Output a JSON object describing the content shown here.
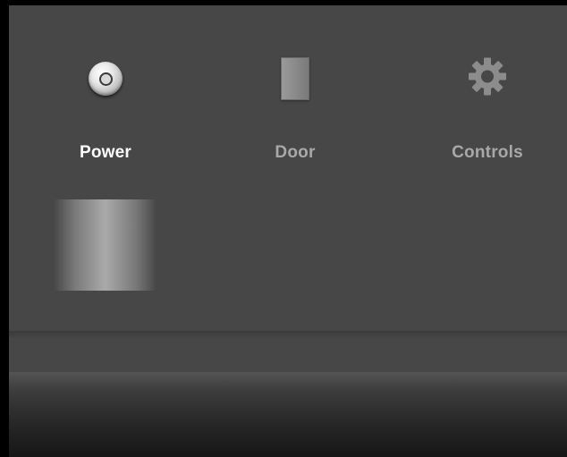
{
  "tabs": [
    {
      "label": "Power",
      "icon": "power-icon",
      "active": true
    },
    {
      "label": "Door",
      "icon": "door-icon",
      "active": false
    },
    {
      "label": "Controls",
      "icon": "gear-icon",
      "active": false
    }
  ],
  "colors": {
    "panel": "#474747",
    "active_label": "#ffffff",
    "inactive_label": "#a8a8a8"
  }
}
